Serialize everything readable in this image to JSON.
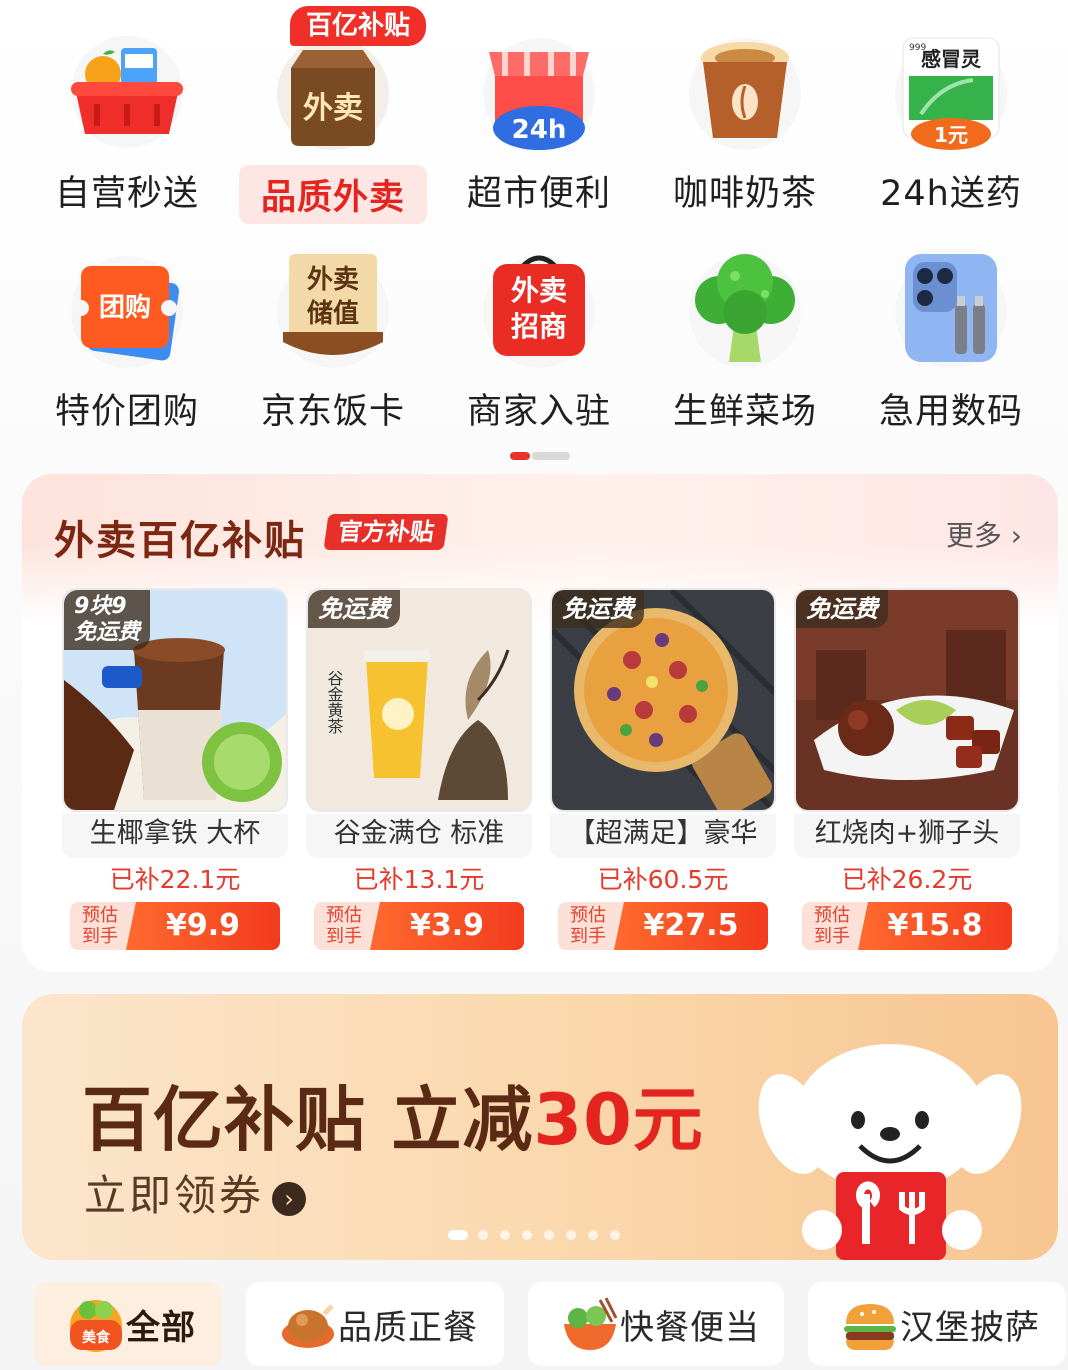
{
  "grid": {
    "badge": "百亿补贴",
    "items": [
      {
        "label": "自营秒送",
        "icon": "basket-icon"
      },
      {
        "label": "品质外卖",
        "icon": "takeout-bag-icon",
        "icon_text": "外卖"
      },
      {
        "label": "超市便利",
        "icon": "store-24h-icon",
        "icon_text": "24h"
      },
      {
        "label": "咖啡奶茶",
        "icon": "coffee-cup-icon"
      },
      {
        "label": "24h送药",
        "icon": "medicine-box-icon",
        "icon_text": "感冒灵",
        "icon_price": "1元",
        "icon_brand": "999"
      },
      {
        "label": "特价团购",
        "icon": "group-buy-ticket-icon",
        "icon_text": "团购"
      },
      {
        "label": "京东饭卡",
        "icon": "takeout-card-icon",
        "icon_text_1": "外卖",
        "icon_text_2": "储值"
      },
      {
        "label": "商家入驻",
        "icon": "merchant-bag-icon",
        "icon_text_1": "外卖",
        "icon_text_2": "招商"
      },
      {
        "label": "生鲜菜场",
        "icon": "broccoli-icon"
      },
      {
        "label": "急用数码",
        "icon": "phone-cable-icon"
      }
    ]
  },
  "subsidy": {
    "title": "外卖百亿补贴",
    "tag": "官方补贴",
    "more": "更多 ›",
    "products": [
      {
        "tag": "9块9\n免运费",
        "name": "生椰拿铁 大杯",
        "subsidy": "已补22.1元",
        "est_1": "预估",
        "est_2": "到手",
        "price": "¥9.9",
        "image": "coconut-latte-photo"
      },
      {
        "tag": "免运费",
        "name": "谷金满仓 标准",
        "subsidy": "已补13.1元",
        "est_1": "预估",
        "est_2": "到手",
        "price": "¥3.9",
        "image": "golden-tea-photo",
        "image_text": "谷金黄茶"
      },
      {
        "tag": "免运费",
        "name": "【超满足】豪华",
        "subsidy": "已补60.5元",
        "est_1": "预估",
        "est_2": "到手",
        "price": "¥27.5",
        "image": "pizza-photo"
      },
      {
        "tag": "免运费",
        "name": "红烧肉+狮子头",
        "subsidy": "已补26.2元",
        "est_1": "预估",
        "est_2": "到手",
        "price": "¥15.8",
        "image": "braised-pork-photo"
      }
    ]
  },
  "banner": {
    "title_part1": "百亿补贴 立减",
    "title_part2": "30元",
    "cta": "立即领券",
    "cta_icon": "chevron-right-circle-icon",
    "mascot": "joy-dog-mascot",
    "dots_total": 8,
    "dots_active": 0
  },
  "tabs": [
    {
      "label": "全部",
      "icon": "food-icon",
      "icon_text": "美食",
      "active": true
    },
    {
      "label": "品质正餐",
      "icon": "roast-chicken-icon",
      "active": false
    },
    {
      "label": "快餐便当",
      "icon": "bento-bowl-icon",
      "active": false
    },
    {
      "label": "汉堡披萨",
      "icon": "burger-icon",
      "active": false
    }
  ],
  "colors": {
    "accent": "#e4251f",
    "brown": "#7b2712",
    "price_orange": "#f23b1e"
  }
}
